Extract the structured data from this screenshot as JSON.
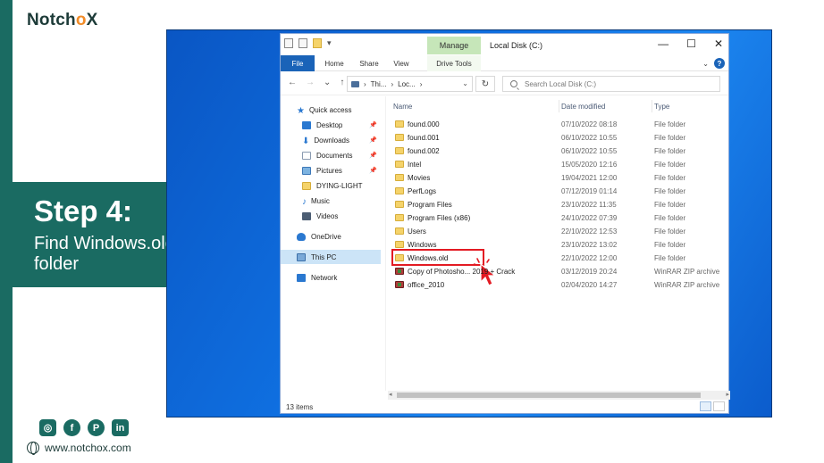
{
  "brand": {
    "logo_prefix": "Notch",
    "logo_accent": "o",
    "logo_suffix": "X",
    "accent_color": "#f28c28",
    "primary_color": "#1a6b62"
  },
  "step": {
    "title": "Step 4:",
    "line1": "Find Windows.old",
    "line2": "folder"
  },
  "social": {
    "icons": [
      "instagram-icon",
      "facebook-icon",
      "pinterest-icon",
      "linkedin-icon"
    ],
    "website": "www.notchox.com"
  },
  "explorer": {
    "manage_label": "Manage",
    "window_title": "Local Disk (C:)",
    "controls": {
      "minimize": "—",
      "maximize": "☐",
      "close": "✕"
    },
    "ribbon_tabs": {
      "file": "File",
      "home": "Home",
      "share": "Share",
      "view": "View",
      "drive_tools": "Drive Tools"
    },
    "address": {
      "crumb1": "Thi...",
      "crumb2": "Loc..."
    },
    "search_placeholder": "Search Local Disk (C:)",
    "nav": {
      "quick_access": "Quick access",
      "desktop": "Desktop",
      "downloads": "Downloads",
      "documents": "Documents",
      "pictures": "Pictures",
      "dying_light": "DYING-LIGHT",
      "music": "Music",
      "videos": "Videos",
      "onedrive": "OneDrive",
      "this_pc": "This PC",
      "network": "Network"
    },
    "columns": {
      "name": "Name",
      "date": "Date modified",
      "type": "Type"
    },
    "files": [
      {
        "name": "found.000",
        "date": "07/10/2022 08:18",
        "type": "File folder"
      },
      {
        "name": "found.001",
        "date": "06/10/2022 10:55",
        "type": "File folder"
      },
      {
        "name": "found.002",
        "date": "06/10/2022 10:55",
        "type": "File folder"
      },
      {
        "name": "Intel",
        "date": "15/05/2020 12:16",
        "type": "File folder"
      },
      {
        "name": "Movies",
        "date": "19/04/2021 12:00",
        "type": "File folder"
      },
      {
        "name": "PerfLogs",
        "date": "07/12/2019 01:14",
        "type": "File folder"
      },
      {
        "name": "Program Files",
        "date": "23/10/2022 11:35",
        "type": "File folder"
      },
      {
        "name": "Program Files (x86)",
        "date": "24/10/2022 07:39",
        "type": "File folder"
      },
      {
        "name": "Users",
        "date": "22/10/2022 12:53",
        "type": "File folder"
      },
      {
        "name": "Windows",
        "date": "23/10/2022 13:02",
        "type": "File folder"
      },
      {
        "name": "Windows.old",
        "date": "22/10/2022 12:00",
        "type": "File folder"
      },
      {
        "name": "Copy of Photosho... 2019 + Crack",
        "date": "03/12/2019 20:24",
        "type": "WinRAR ZIP archive"
      },
      {
        "name": "office_2010",
        "date": "02/04/2020 14:27",
        "type": "WinRAR ZIP archive"
      }
    ],
    "status_count": "13 items"
  }
}
